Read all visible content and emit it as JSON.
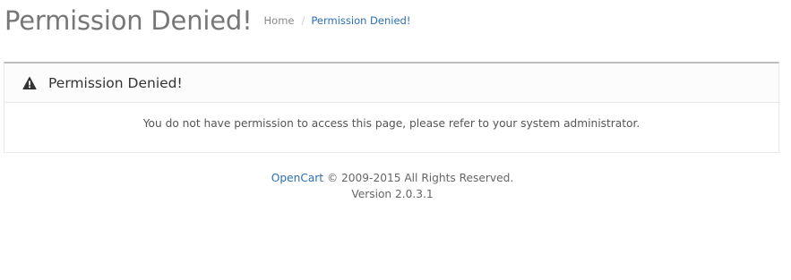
{
  "header": {
    "title": "Permission Denied!",
    "breadcrumb": [
      {
        "label": "Home"
      },
      {
        "label": "Permission Denied!"
      }
    ],
    "breadcrumb_separator": "/"
  },
  "panel": {
    "icon": "warning-icon",
    "title": "Permission Denied!",
    "message": "You do not have permission to access this page, please refer to your system administrator."
  },
  "footer": {
    "brand_link": "OpenCart",
    "copyright": " © 2009-2015 All Rights Reserved.",
    "version": "Version 2.0.3.1"
  },
  "colors": {
    "link": "#2b6fb6",
    "title": "#777777",
    "panel_border_top": "#bfbfbf"
  }
}
